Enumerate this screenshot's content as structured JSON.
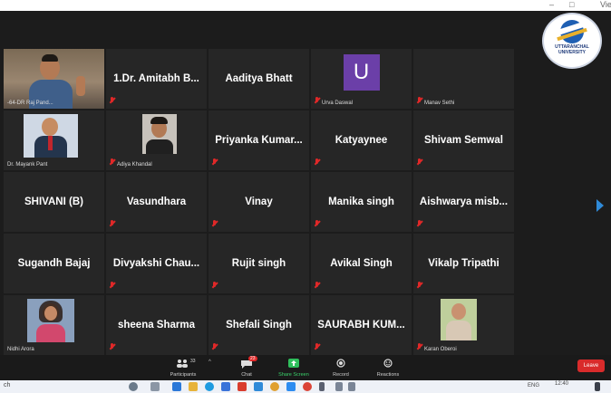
{
  "window": {
    "partial_label": "Vie",
    "min": "–",
    "max": "□"
  },
  "logo": {
    "text": "UTTARANCHAL UNIVERSITY"
  },
  "tiles": [
    {
      "type": "video",
      "small": "-64-DR Raj Pand..."
    },
    {
      "type": "name",
      "name": "1.Dr. Amitabh B..."
    },
    {
      "type": "name",
      "name": "Aaditya Bhatt"
    },
    {
      "type": "avatar",
      "letter": "U",
      "small": "Urva Daswal"
    },
    {
      "type": "blank",
      "small": "Manav Sethi"
    },
    {
      "type": "photo",
      "small": "Dr. Mayank Pant"
    },
    {
      "type": "photo",
      "small": "Adiya Khandal"
    },
    {
      "type": "name",
      "name": "Priyanka Kumar..."
    },
    {
      "type": "name",
      "name": "Katyaynee"
    },
    {
      "type": "name",
      "name": "Shivam Semwal"
    },
    {
      "type": "name",
      "name": "SHIVANI (B)"
    },
    {
      "type": "name",
      "name": "Vasundhara"
    },
    {
      "type": "name",
      "name": "Vinay"
    },
    {
      "type": "name",
      "name": "Manika singh"
    },
    {
      "type": "name",
      "name": "Aishwarya misb..."
    },
    {
      "type": "name",
      "name": "Sugandh Bajaj"
    },
    {
      "type": "name",
      "name": "Divyakshi Chau..."
    },
    {
      "type": "name",
      "name": "Rujit singh"
    },
    {
      "type": "name",
      "name": "Avikal Singh"
    },
    {
      "type": "name",
      "name": "Vikalp Tripathi"
    },
    {
      "type": "photo",
      "small": "Nidhi Arora"
    },
    {
      "type": "name",
      "name": "sheena Sharma"
    },
    {
      "type": "name",
      "name": "Shefali Singh"
    },
    {
      "type": "name",
      "name": "SAURABH KUM..."
    },
    {
      "type": "photo",
      "small": "Karan Oberoi"
    }
  ],
  "toolbar": {
    "participants_label": "Participants",
    "participants_count": "33",
    "chat_label": "Chat",
    "chat_badge": "23",
    "share_label": "Share Screen",
    "record_label": "Record",
    "reactions_label": "Reactions",
    "leave_label": "Leave"
  },
  "taskbar": {
    "search": "ch",
    "lang": "ENG",
    "time": "12:40"
  },
  "colors": {
    "accent_green": "#3ad36b",
    "leave_red": "#d92b2b",
    "active_border": "#d7e04a",
    "avatar_purple": "#6b3fa8"
  }
}
